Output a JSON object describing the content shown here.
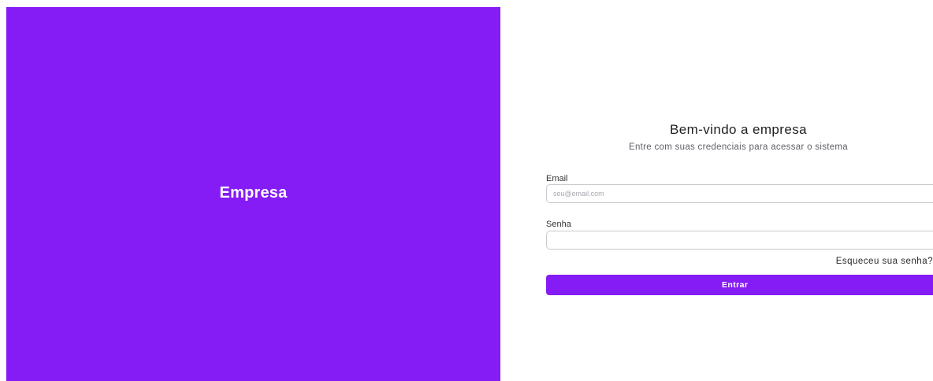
{
  "brand": {
    "name": "Empresa",
    "panel_color": "#861cf5"
  },
  "login": {
    "title": "Bem-vindo a empresa",
    "subtitle": "Entre com suas credenciais para acessar o sistema",
    "email": {
      "label": "Email",
      "placeholder": "seu@email.com",
      "value": ""
    },
    "password": {
      "label": "Senha",
      "placeholder": "",
      "value": ""
    },
    "forgot_password": "Esqueceu sua senha?",
    "submit_label": "Entrar",
    "accent_color": "#861cf5"
  }
}
